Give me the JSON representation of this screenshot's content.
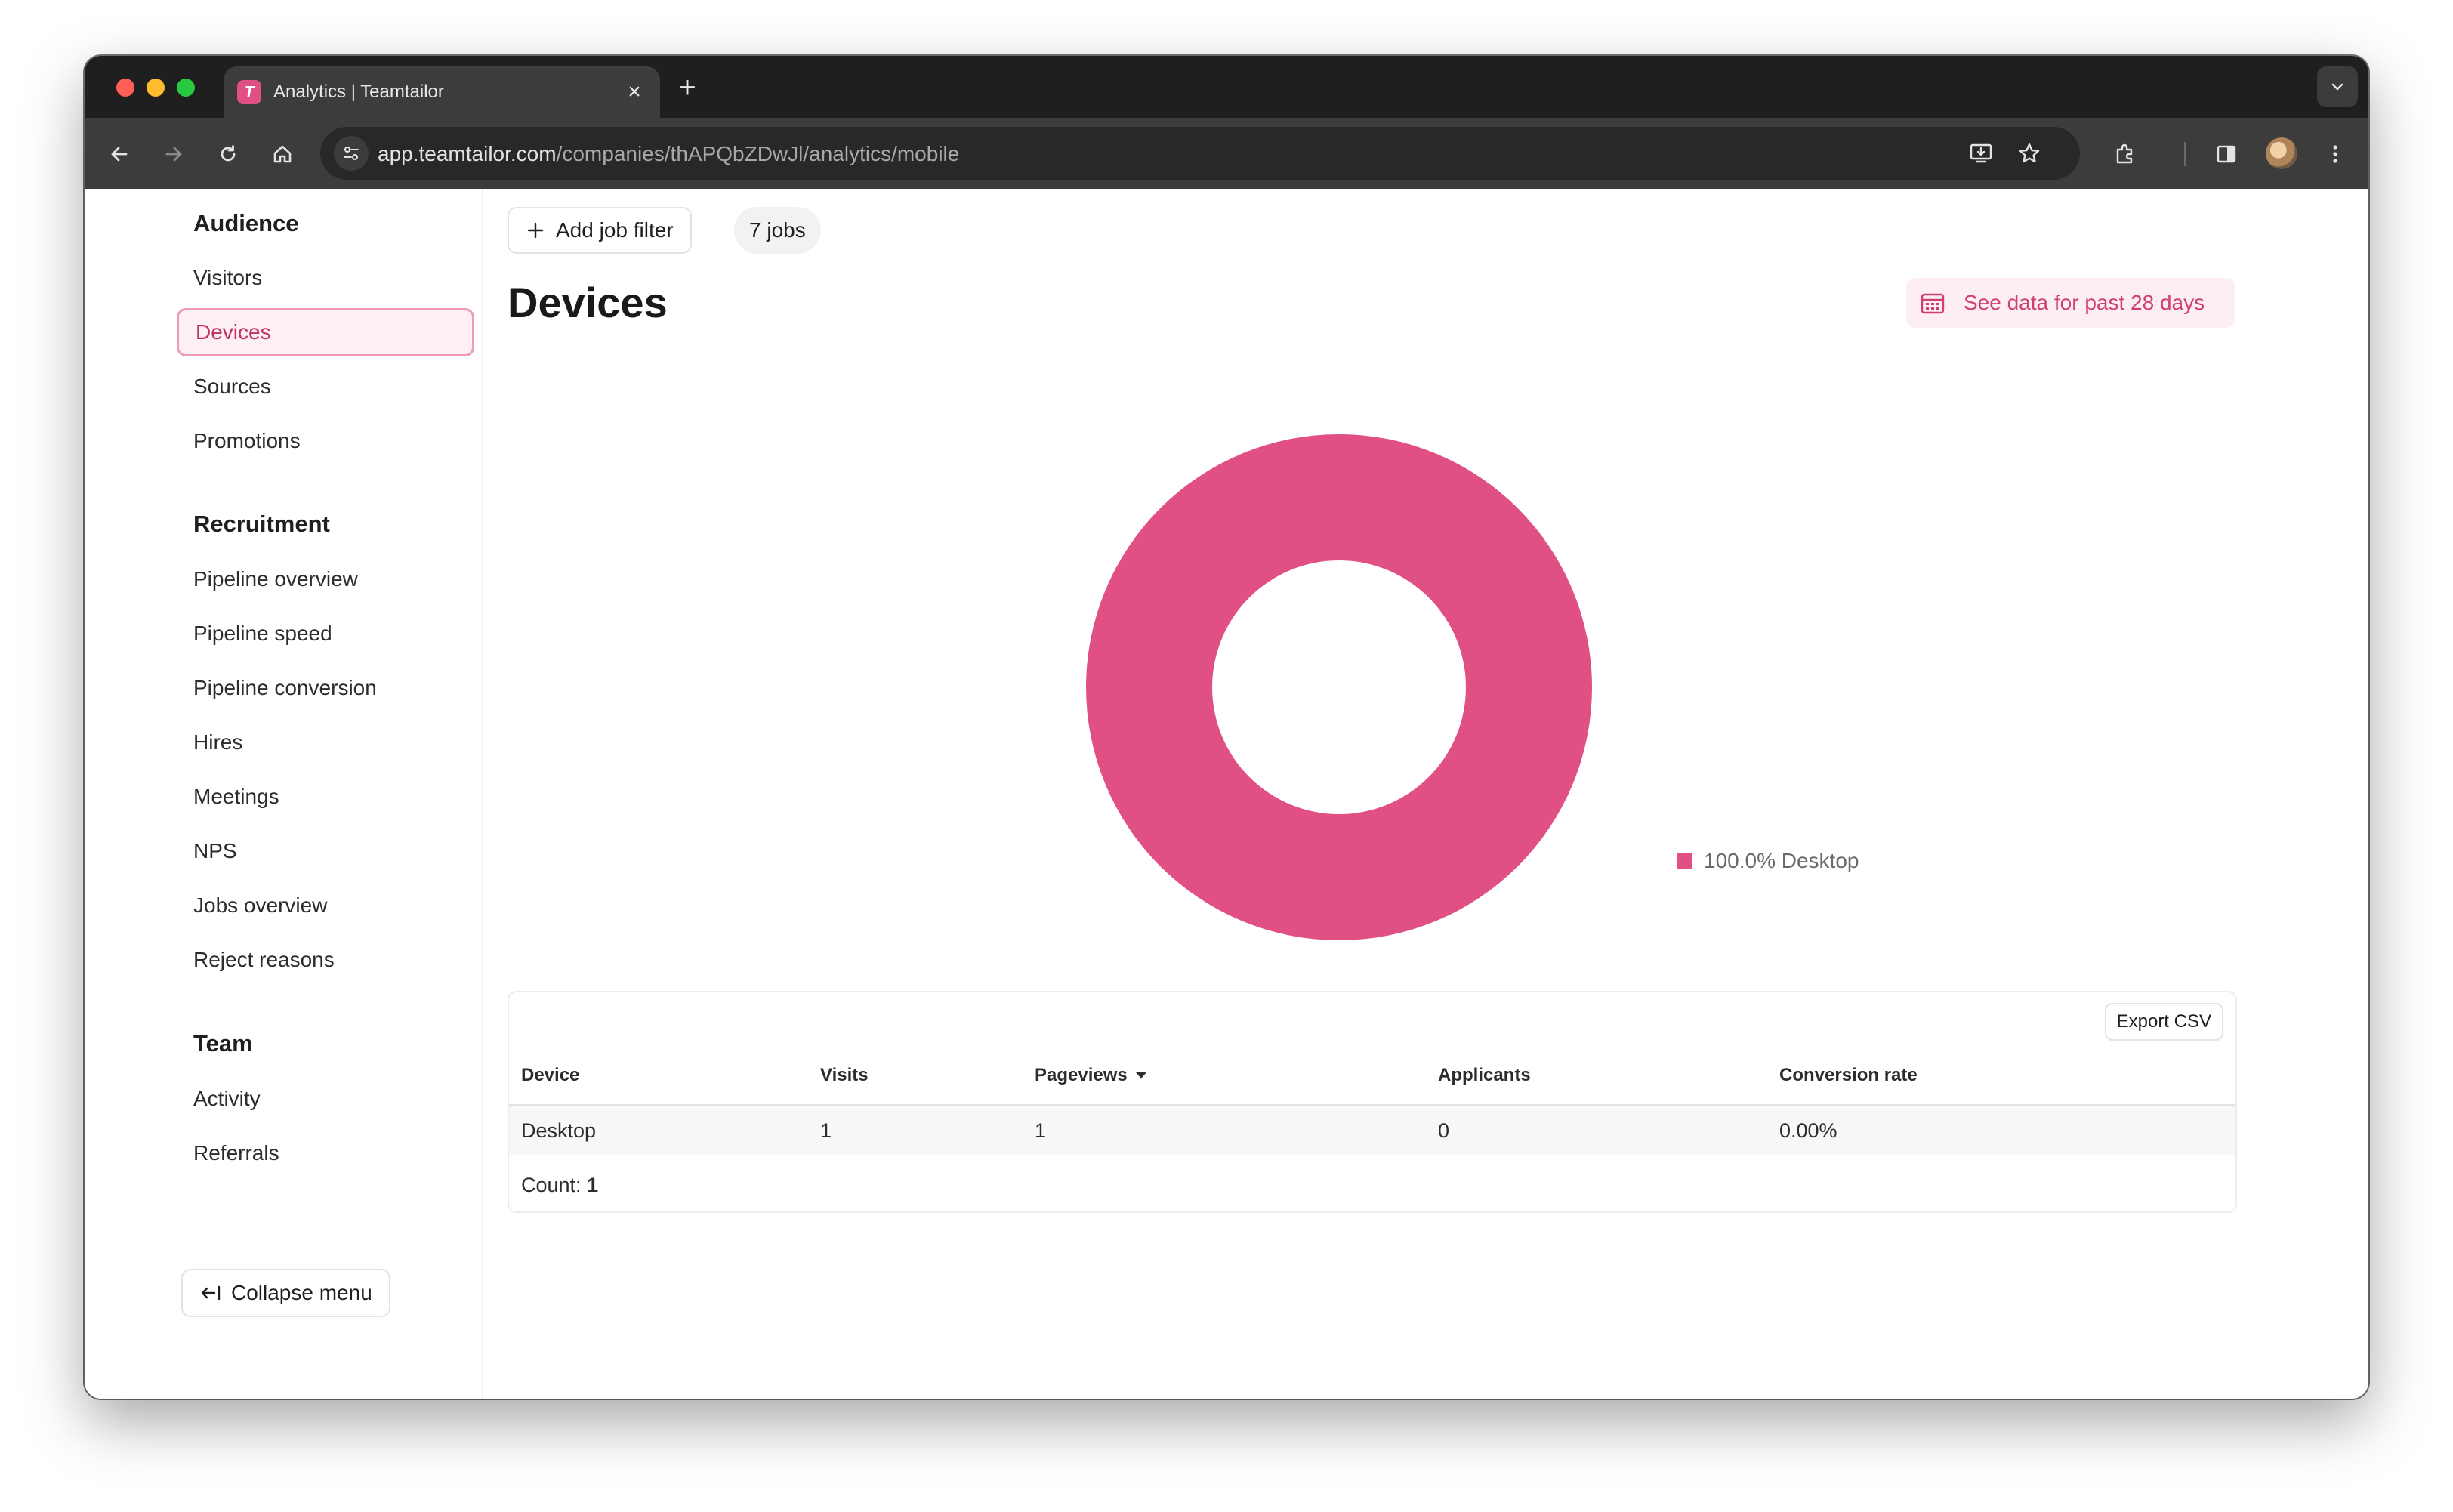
{
  "browser": {
    "tab_title": "Analytics | Teamtailor",
    "favicon_letter": "T",
    "url_host": "app.teamtailor.com",
    "url_path": "/companies/thAPQbZDwJl/analytics/mobile"
  },
  "sidebar": {
    "sections": [
      {
        "title": "Audience",
        "items": [
          "Visitors",
          "Devices",
          "Sources",
          "Promotions"
        ]
      },
      {
        "title": "Recruitment",
        "items": [
          "Pipeline overview",
          "Pipeline speed",
          "Pipeline conversion",
          "Hires",
          "Meetings",
          "NPS",
          "Jobs overview",
          "Reject reasons"
        ]
      },
      {
        "title": "Team",
        "items": [
          "Activity",
          "Referrals"
        ]
      }
    ],
    "active_item": "Devices",
    "collapse_label": "Collapse menu"
  },
  "main": {
    "add_filter_label": "Add job filter",
    "jobs_pill": "7 jobs",
    "page_title": "Devices",
    "date_range_label": "See data for past 28 days"
  },
  "chart_data": {
    "type": "pie",
    "donut": true,
    "categories": [
      "Desktop"
    ],
    "values": [
      100.0
    ],
    "legend": [
      "100.0% Desktop"
    ],
    "legend_position": "right",
    "colors": [
      "#e05085"
    ]
  },
  "table": {
    "export_label": "Export CSV",
    "columns": [
      "Device",
      "Visits",
      "Pageviews",
      "Applicants",
      "Conversion rate"
    ],
    "sorted_column": "Pageviews",
    "rows": [
      [
        "Desktop",
        "1",
        "1",
        "0",
        "0.00%"
      ]
    ],
    "count_label": "Count:",
    "count_value": "1"
  },
  "colors": {
    "accent": "#e05085",
    "accent_dark": "#c2305f",
    "accent_bg": "#fdeef3"
  }
}
